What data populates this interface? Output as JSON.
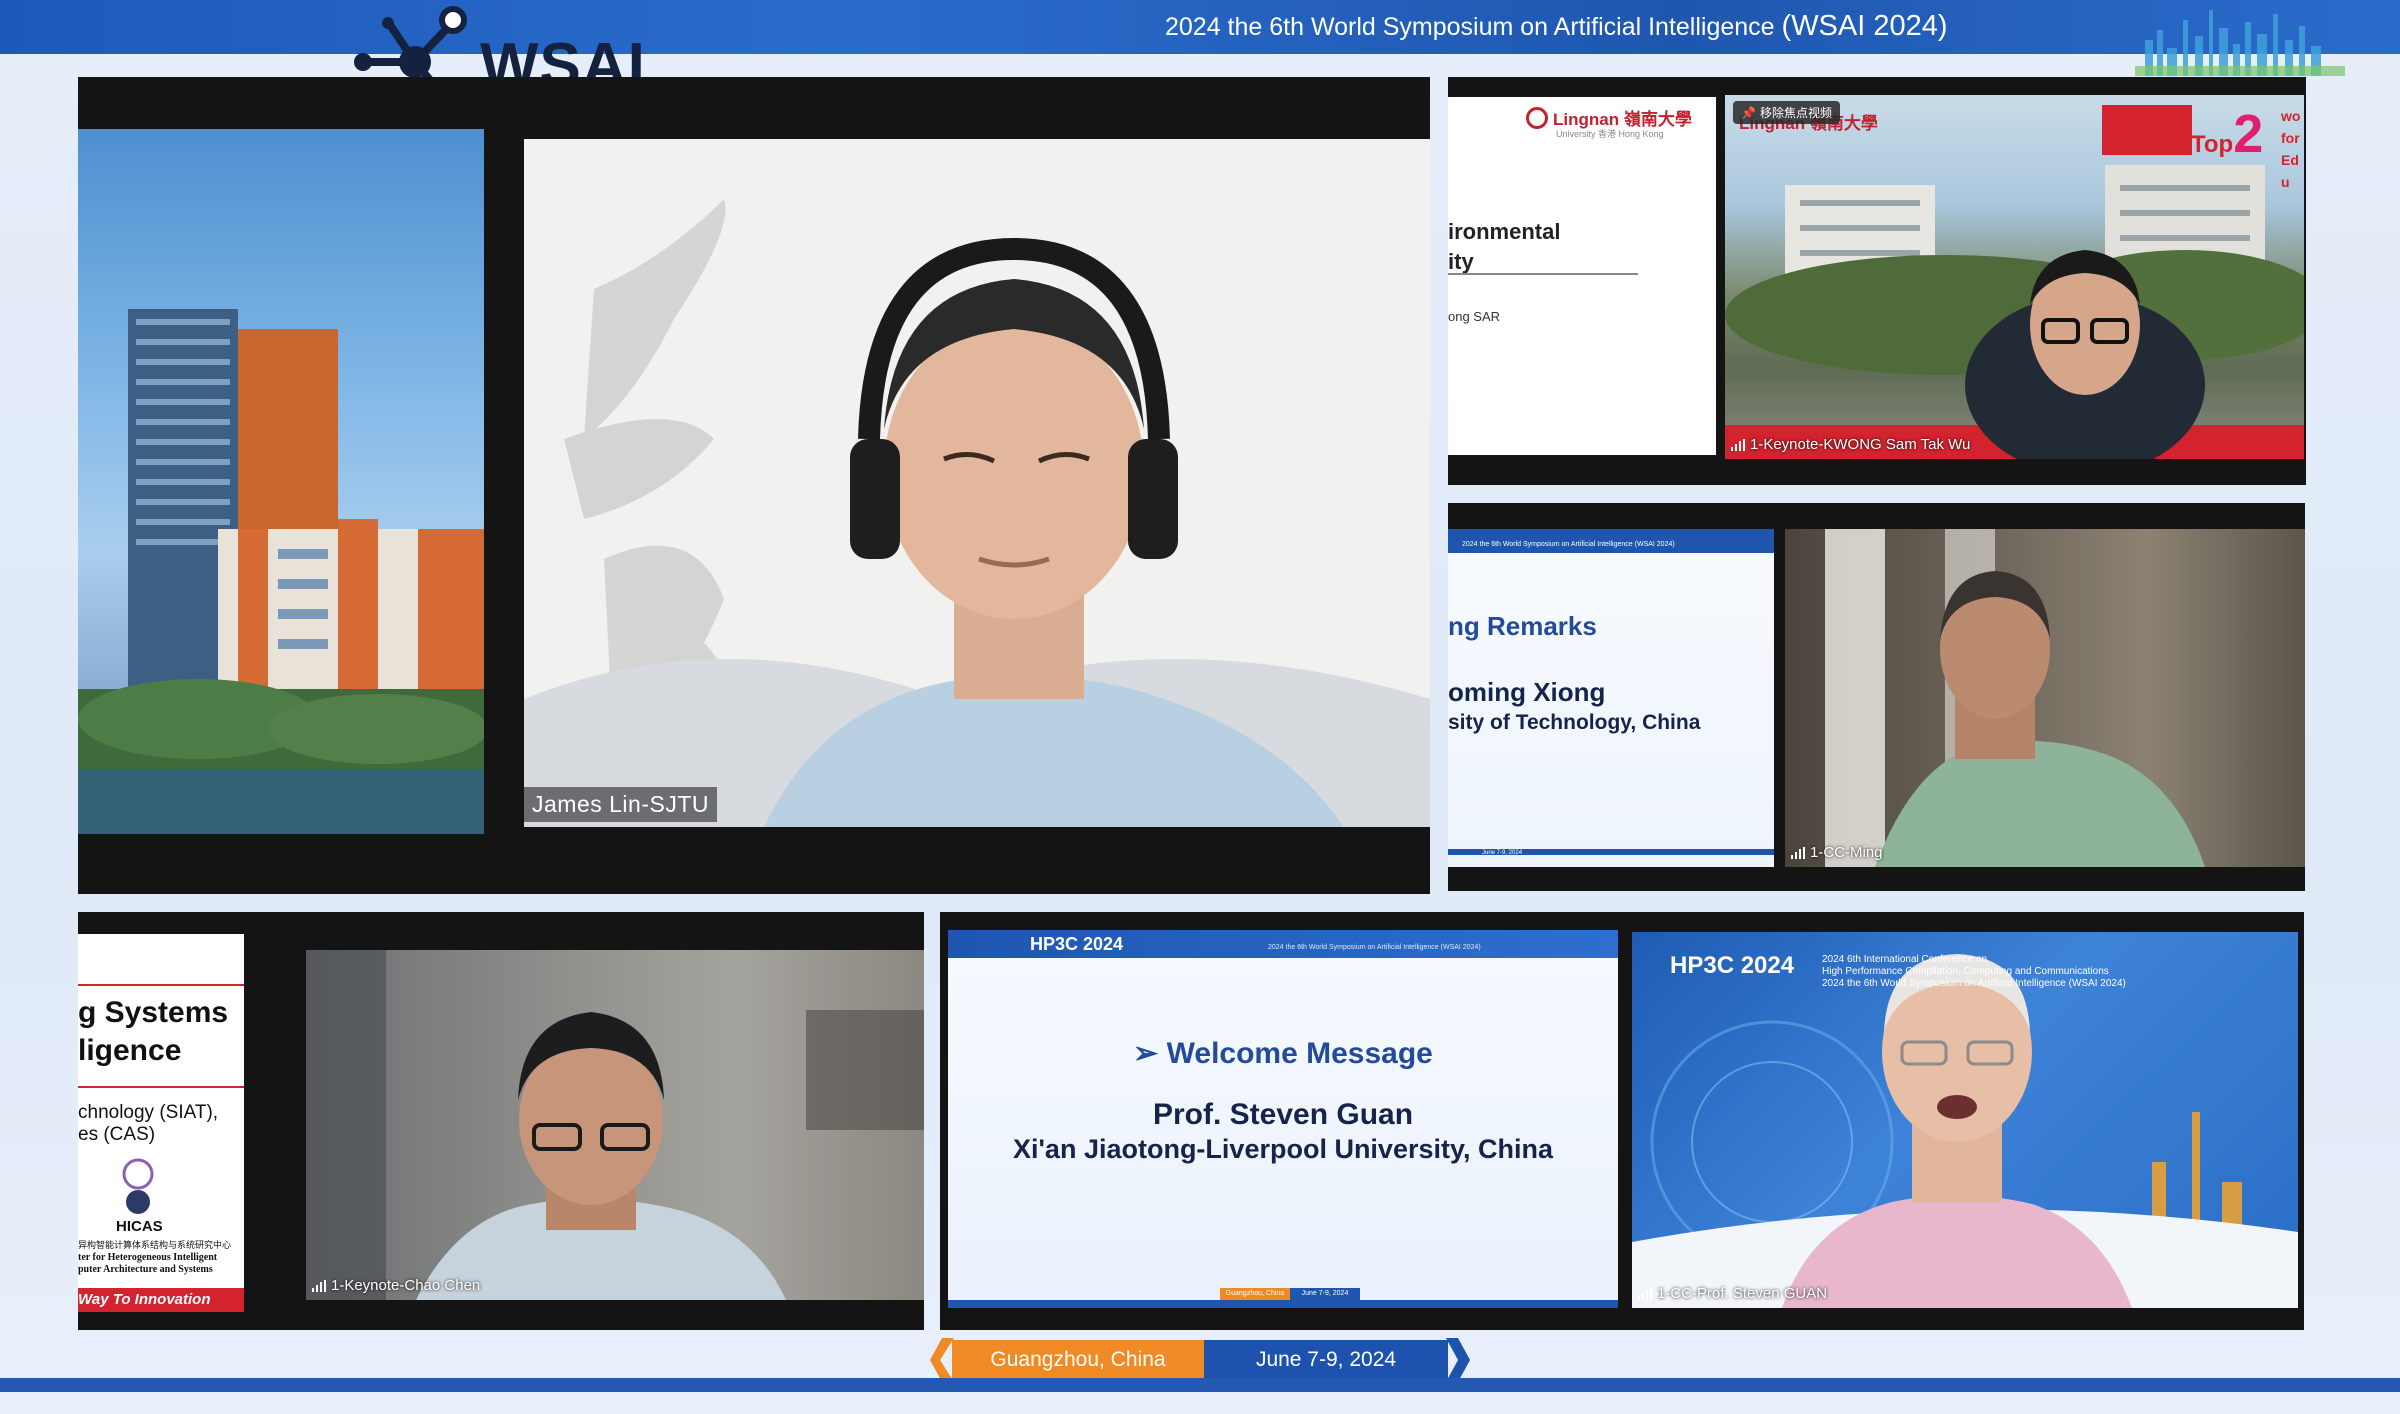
{
  "header": {
    "title_prefix": "2024 the 6th World Symposium on Artificial Intelligence ",
    "title_suffix": "(WSAI 2024)",
    "logo_text": "WSAI"
  },
  "colors": {
    "brand_blue": "#1d59b8",
    "orange": "#f08a24",
    "tile_bg": "#141414"
  },
  "main_speaker": {
    "name": "James Lin-SJTU"
  },
  "slide_kwong": {
    "logo_text": "Lingnan 嶺南大學",
    "logo_sub": "University 香港 Hong Kong",
    "line1": "ironmental",
    "line2": "ity",
    "line3": "ong SAR"
  },
  "kwong": {
    "name": "1-Keynote-KWONG Sam Tak Wu",
    "badge": "移除焦点视频",
    "top2": "Top",
    "top2_num": "2",
    "side_text": "wo for Edu"
  },
  "slide_ming": {
    "header_small": "2024 the 6th World Symposium on Artificial Intelligence (WSAI 2024)",
    "line1": "ng Remarks",
    "line2": "oming Xiong",
    "line3": "sity of Technology, China",
    "footer_date": "June 7-9, 2024"
  },
  "ming": {
    "name": "1-CC-Ming"
  },
  "slide_chao": {
    "line1": "g Systems",
    "line2": "ligence",
    "line3": "chnology (SIAT),",
    "line4": "es (CAS)",
    "hicas": "HICAS",
    "cn": "异构智能计算体系结构与系统研究中心",
    "en1": "ter for Heterogeneous Intelligent",
    "en2": "puter Architecture and Systems",
    "footer": "Way To Innovation"
  },
  "chao": {
    "name": "1-Keynote-Chao Chen"
  },
  "slide_guan": {
    "badge": "HP3C 2024",
    "header_small": "2024 the 6th World Symposium on Artificial Intelligence (WSAI 2024)",
    "title": "➢ Welcome Message",
    "name": "Prof. Steven Guan",
    "affil": "Xi'an Jiaotong-Liverpool University, China",
    "footer_loc": "Guangzhou, China",
    "footer_date": "June 7-9, 2024"
  },
  "guan": {
    "name": "1-CC-Prof. Steven GUAN",
    "badge": "HP3C 2024",
    "sub1": "2024 6th International Conference on",
    "sub2": "High Performance Compilation, Computing and Communications",
    "sub3": "2024 the 6th World Symposium on Artificial Intelligence (WSAI 2024)"
  },
  "footer": {
    "location": "Guangzhou, China",
    "date": "June 7-9, 2024"
  }
}
